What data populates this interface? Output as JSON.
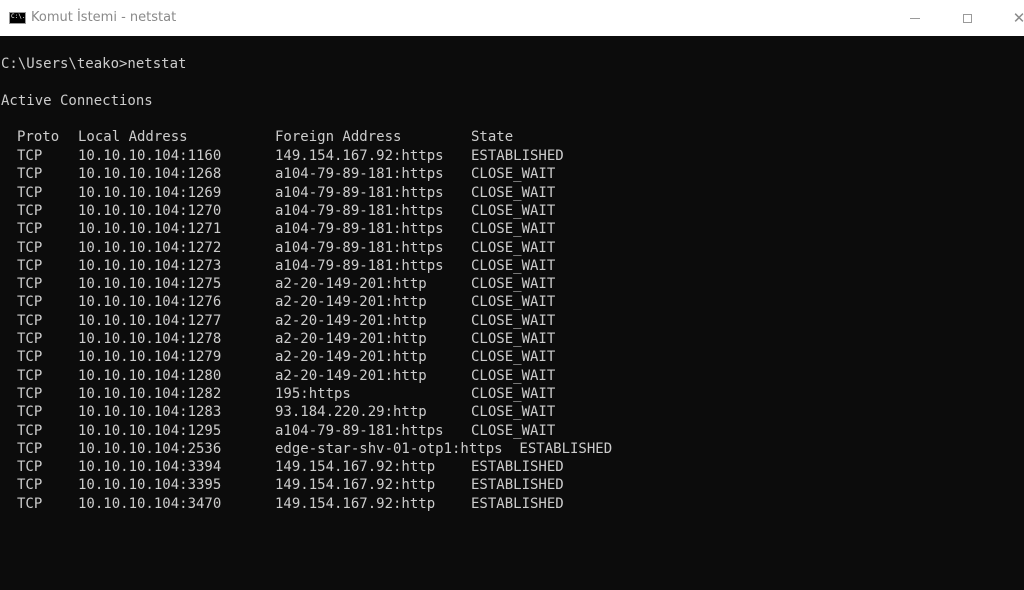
{
  "window": {
    "icon_text": "C:\\.",
    "title": "Komut İstemi - netstat",
    "minimize_glyph": "",
    "close_glyph": "✕"
  },
  "console": {
    "prompt_line": "C:\\Users\\teako>netstat",
    "heading": "Active Connections",
    "columns": {
      "proto": "Proto",
      "local": "Local Address",
      "foreign": "Foreign Address",
      "state": "State"
    },
    "rows": [
      {
        "proto": "TCP",
        "local": "10.10.10.104:1160",
        "foreign": "149.154.167.92:https",
        "state": "ESTABLISHED"
      },
      {
        "proto": "TCP",
        "local": "10.10.10.104:1268",
        "foreign": "a104-79-89-181:https",
        "state": "CLOSE_WAIT"
      },
      {
        "proto": "TCP",
        "local": "10.10.10.104:1269",
        "foreign": "a104-79-89-181:https",
        "state": "CLOSE_WAIT"
      },
      {
        "proto": "TCP",
        "local": "10.10.10.104:1270",
        "foreign": "a104-79-89-181:https",
        "state": "CLOSE_WAIT"
      },
      {
        "proto": "TCP",
        "local": "10.10.10.104:1271",
        "foreign": "a104-79-89-181:https",
        "state": "CLOSE_WAIT"
      },
      {
        "proto": "TCP",
        "local": "10.10.10.104:1272",
        "foreign": "a104-79-89-181:https",
        "state": "CLOSE_WAIT"
      },
      {
        "proto": "TCP",
        "local": "10.10.10.104:1273",
        "foreign": "a104-79-89-181:https",
        "state": "CLOSE_WAIT"
      },
      {
        "proto": "TCP",
        "local": "10.10.10.104:1275",
        "foreign": "a2-20-149-201:http",
        "state": "CLOSE_WAIT"
      },
      {
        "proto": "TCP",
        "local": "10.10.10.104:1276",
        "foreign": "a2-20-149-201:http",
        "state": "CLOSE_WAIT"
      },
      {
        "proto": "TCP",
        "local": "10.10.10.104:1277",
        "foreign": "a2-20-149-201:http",
        "state": "CLOSE_WAIT"
      },
      {
        "proto": "TCP",
        "local": "10.10.10.104:1278",
        "foreign": "a2-20-149-201:http",
        "state": "CLOSE_WAIT"
      },
      {
        "proto": "TCP",
        "local": "10.10.10.104:1279",
        "foreign": "a2-20-149-201:http",
        "state": "CLOSE_WAIT"
      },
      {
        "proto": "TCP",
        "local": "10.10.10.104:1280",
        "foreign": "a2-20-149-201:http",
        "state": "CLOSE_WAIT"
      },
      {
        "proto": "TCP",
        "local": "10.10.10.104:1282",
        "foreign": "195:https",
        "state": "CLOSE_WAIT"
      },
      {
        "proto": "TCP",
        "local": "10.10.10.104:1283",
        "foreign": "93.184.220.29:http",
        "state": "CLOSE_WAIT"
      },
      {
        "proto": "TCP",
        "local": "10.10.10.104:1295",
        "foreign": "a104-79-89-181:https",
        "state": "CLOSE_WAIT"
      },
      {
        "proto": "TCP",
        "local": "10.10.10.104:2536",
        "foreign": "edge-star-shv-01-otp1:https  ESTABLISHED",
        "state": ""
      },
      {
        "proto": "TCP",
        "local": "10.10.10.104:3394",
        "foreign": "149.154.167.92:http",
        "state": "ESTABLISHED"
      },
      {
        "proto": "TCP",
        "local": "10.10.10.104:3395",
        "foreign": "149.154.167.92:http",
        "state": "ESTABLISHED"
      },
      {
        "proto": "TCP",
        "local": "10.10.10.104:3470",
        "foreign": "149.154.167.92:http",
        "state": "ESTABLISHED"
      }
    ]
  },
  "colors": {
    "console_bg": "#0c0c0c",
    "console_text": "#cccccc",
    "titlebar_bg": "#ffffff"
  }
}
